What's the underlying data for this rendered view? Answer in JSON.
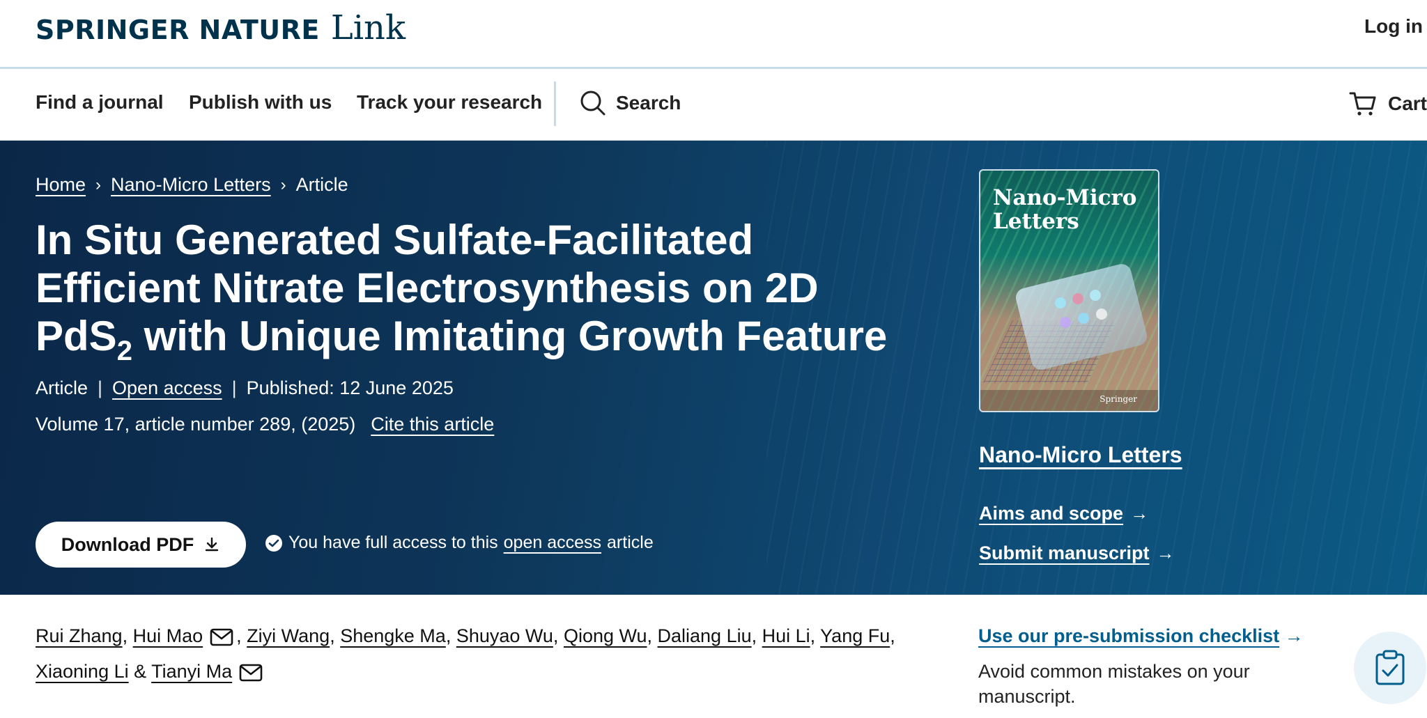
{
  "header": {
    "brand_main": "SPRINGER NATURE",
    "brand_sub": "Link",
    "login": "Log in"
  },
  "nav": {
    "items": [
      "Find a journal",
      "Publish with us",
      "Track your research"
    ],
    "search": "Search",
    "cart": "Cart"
  },
  "breadcrumb": [
    "Home",
    "Nano-Micro Letters",
    "Article"
  ],
  "article": {
    "title_part1": "In Situ Generated Sulfate-Facilitated Efficient Nitrate Electrosynthesis on 2D PdS",
    "title_subscript": "2",
    "title_part2": " with Unique Imitating Growth Feature",
    "type": "Article",
    "access": "Open access",
    "published": "Published: 12 June 2025",
    "volume": "Volume 17, article number 289, (2025)",
    "cite": "Cite this article"
  },
  "download": {
    "label": "Download PDF",
    "access_pre": "You have full access to this",
    "access_link": "open access",
    "access_post": "article"
  },
  "journal": {
    "cover_title": "Nano-Micro Letters",
    "cover_publisher": "Springer",
    "name": "Nano-Micro Letters",
    "aims": "Aims and scope",
    "submit": "Submit manuscript"
  },
  "authors": {
    "list": [
      "Rui Zhang",
      "Hui Mao",
      "Ziyi Wang",
      "Shengke Ma",
      "Shuyao Wu",
      "Qiong Wu",
      "Daliang Liu",
      "Hui Li",
      "Yang Fu",
      "Xiaoning Li",
      "Tianyi Ma"
    ],
    "and": "&"
  },
  "sidebar": {
    "checklist": "Use our pre-submission checklist",
    "checklist_desc": "Avoid common mistakes on your manuscript."
  },
  "colors": {
    "brand": "#01324b",
    "hero_dark": "#0b2748",
    "hero_light": "#0b5a85",
    "link_blue": "#025e8d"
  }
}
